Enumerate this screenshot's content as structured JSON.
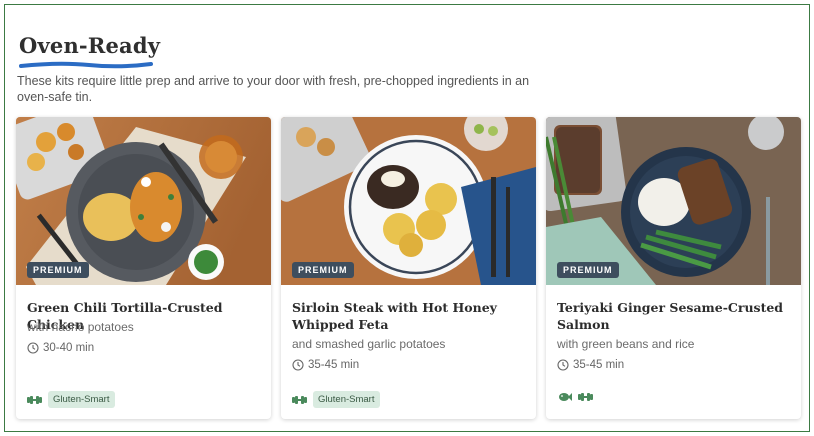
{
  "section": {
    "title": "Oven-Ready",
    "description": "These kits require little prep and arrive to your door with fresh, pre-chopped ingredients in an oven-safe tin.",
    "accent_color": "#2b6cc4"
  },
  "cards": [
    {
      "badge": "PREMIUM",
      "title": "Green Chili Tortilla-Crusted Chicken",
      "subtitle": "with nacho potatoes",
      "time": "30-40 min",
      "icons": [
        "dumbbell-icon"
      ],
      "tag": "Gluten-Smart"
    },
    {
      "badge": "PREMIUM",
      "title": "Sirloin Steak with Hot Honey Whipped Feta",
      "subtitle": "and smashed garlic potatoes",
      "time": "35-45 min",
      "icons": [
        "dumbbell-icon"
      ],
      "tag": "Gluten-Smart"
    },
    {
      "badge": "PREMIUM",
      "title": "Teriyaki Ginger Sesame-Crusted Salmon",
      "subtitle": "with green beans and rice",
      "time": "35-45 min",
      "icons": [
        "fish-icon",
        "dumbbell-icon"
      ],
      "tag": ""
    }
  ],
  "colors": {
    "badge_bg": "#3e4e5e",
    "tag_bg": "#d9ebe0",
    "icon_green": "#4a8a5c",
    "frame_border": "#3c7a43"
  }
}
